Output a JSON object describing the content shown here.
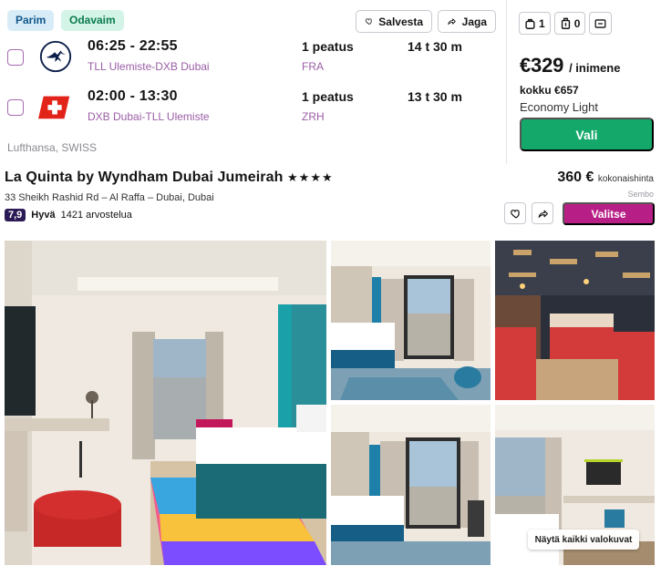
{
  "flight": {
    "tags": {
      "best": "Parim",
      "cheapest": "Odavaim"
    },
    "actions": {
      "save": "Salvesta",
      "share": "Jaga"
    },
    "legs": [
      {
        "airline_icon": "lufthansa-crane-logo",
        "times": "06:25 - 22:55",
        "route": "TLL Ulemiste-DXB Dubai",
        "stops": "1 peatus",
        "via": "FRA",
        "duration": "14 t 30 m"
      },
      {
        "airline_icon": "swiss-cross-logo",
        "times": "02:00 - 13:30",
        "route": "DXB Dubai-TLL Ulemiste",
        "stops": "1 peatus",
        "via": "ZRH",
        "duration": "13 t 30 m"
      }
    ],
    "airlines": "Lufthansa, SWISS",
    "baggage": {
      "personal": "1",
      "carry_on": "0",
      "checked_icon": "checked-bag-icon"
    },
    "price": {
      "amount": "€329",
      "per": "/ inimene",
      "total": "kokku €657",
      "fare_class": "Economy Light",
      "select_label": "Vali"
    }
  },
  "hotel": {
    "name": "La Quinta by Wyndham Dubai Jumeirah",
    "stars": "★★★★",
    "address": "33 Sheikh Rashid Rd – Al Raffa – Dubai, Dubai",
    "score": "7,9",
    "score_word": "Hyvä",
    "reviews": "1421 arvostelua",
    "price": "360 €",
    "price_note": "kokonaishinta",
    "provider": "Sembo",
    "choose_label": "Valitse",
    "view_all_label": "Näytä kaikki valokuvat"
  },
  "colors": {
    "select_green": "#14a86a",
    "choose_magenta": "#b81f86",
    "score_navy": "#2b1a55",
    "muted_purple": "#9b5da6"
  }
}
